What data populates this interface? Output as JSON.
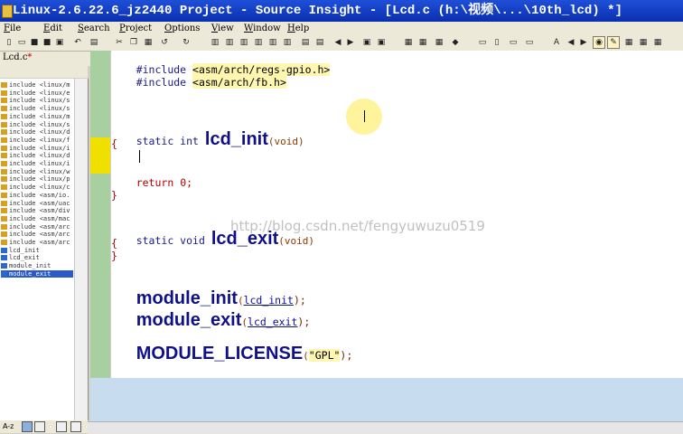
{
  "window": {
    "title": "Linux-2.6.22.6_jz2440 Project - Source Insight - [Lcd.c (h:\\视频\\...\\10th_lcd) *]"
  },
  "menu": [
    "File",
    "Edit",
    "Search",
    "Project",
    "Options",
    "View",
    "Window",
    "Help"
  ],
  "tab": {
    "name": "Lcd.c",
    "modified": "*"
  },
  "symbols": [
    {
      "label": "include <linux/m",
      "kind": "inc"
    },
    {
      "label": "include <linux/e",
      "kind": "inc"
    },
    {
      "label": "include <linux/s",
      "kind": "inc"
    },
    {
      "label": "include <linux/s",
      "kind": "inc"
    },
    {
      "label": "include <linux/m",
      "kind": "inc"
    },
    {
      "label": "include <linux/s",
      "kind": "inc"
    },
    {
      "label": "include <linux/d",
      "kind": "inc"
    },
    {
      "label": "include <linux/f",
      "kind": "inc"
    },
    {
      "label": "include <linux/i",
      "kind": "inc"
    },
    {
      "label": "include <linux/d",
      "kind": "inc"
    },
    {
      "label": "include <linux/i",
      "kind": "inc"
    },
    {
      "label": "include <linux/w",
      "kind": "inc"
    },
    {
      "label": "include <linux/p",
      "kind": "inc"
    },
    {
      "label": "include <linux/c",
      "kind": "inc"
    },
    {
      "label": "include <asm/io.",
      "kind": "inc"
    },
    {
      "label": "include <asm/uac",
      "kind": "inc"
    },
    {
      "label": "include <asm/div",
      "kind": "inc"
    },
    {
      "label": "include <asm/mac",
      "kind": "inc"
    },
    {
      "label": "include <asm/arc",
      "kind": "inc"
    },
    {
      "label": "include <asm/arc",
      "kind": "inc"
    },
    {
      "label": "include <asm/arc",
      "kind": "inc"
    },
    {
      "label": "lcd_init",
      "kind": "fn"
    },
    {
      "label": "lcd_exit",
      "kind": "fn"
    },
    {
      "label": "module_init",
      "kind": "fn"
    },
    {
      "label": "module_exit",
      "kind": "fn",
      "selected": true
    }
  ],
  "code": {
    "inc1_kw": "#include",
    "inc1_path": "<asm/arch/regs-gpio.h>",
    "inc2_kw": "#include",
    "inc2_path": "<asm/arch/fb.h>",
    "init_prefix": "static int",
    "init_name": "lcd_init",
    "init_params": "(void)",
    "open_brace": "{",
    "return_kw": "return",
    "return_val": "0;",
    "close_brace": "}",
    "exit_prefix": "static void",
    "exit_name": "lcd_exit",
    "exit_params": "(void)",
    "open_brace2": "{",
    "close_brace2": "}",
    "modinit_name": "module_init",
    "modinit_arg": "lcd_init",
    "modexit_name": "module_exit",
    "modexit_arg": "lcd_exit",
    "license_name": "MODULE_LICENSE",
    "license_arg": "\"GPL\"",
    "open_paren": "(",
    "close_paren_semi": ");"
  },
  "watermark": "http://blog.csdn.net/fengyuwuzu0519",
  "bottom": {
    "label": "A-z"
  }
}
